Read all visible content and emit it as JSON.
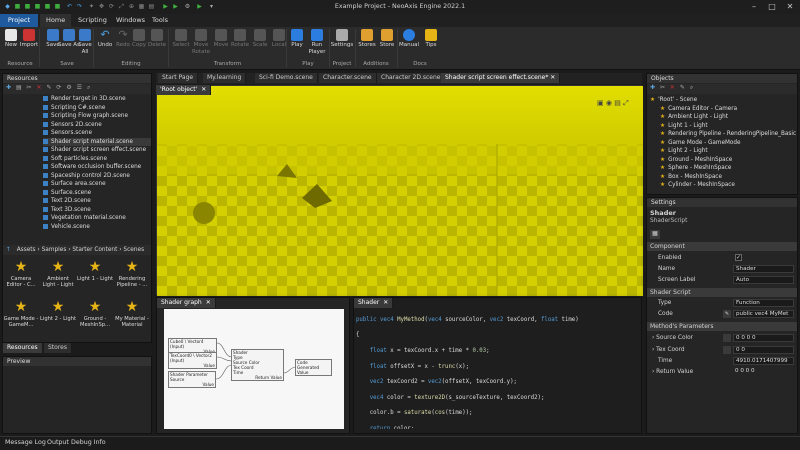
{
  "window": {
    "title": "Example Project - NeoAxis Engine 2022.1"
  },
  "menu": {
    "project": "Project",
    "home": "Home",
    "scripting": "Scripting",
    "windows": "Windows",
    "tools": "Tools"
  },
  "ribbon": {
    "new": "New",
    "import": "Import",
    "save": "Save",
    "save_as": "Save As",
    "save_all": "Save All",
    "undo": "Undo",
    "redo": "Redo",
    "copy": "Copy",
    "delete": "Delete",
    "select": "Select",
    "move_rotate": "Move Rotate",
    "move": "Move",
    "rotate": "Rotate",
    "scale": "Scale",
    "local": "Local",
    "play": "Play",
    "run_player": "Run Player",
    "settings": "Settings",
    "stores": "Stores",
    "store": "Store",
    "manual": "Manual",
    "tips": "Tips",
    "groups": {
      "resource": "Resource",
      "save": "Save",
      "editing": "Editing",
      "transform": "Transform",
      "play": "Play",
      "project": "Project",
      "additions": "Additions",
      "docs": "Docs"
    }
  },
  "resources": {
    "title": "Resources",
    "files": [
      "Render target in 3D.scene",
      "Scripting C#.scene",
      "Scripting Flow graph.scene",
      "Sensors 2D.scene",
      "Sensors.scene",
      "Shader script material.scene",
      "Shader script screen effect.scene",
      "Soft particles.scene",
      "Software occlusion buffer.scene",
      "Spaceship control 2D.scene",
      "Surface area.scene",
      "Surface.scene",
      "Text 2D.scene",
      "Text 3D.scene",
      "Vegetation material.scene",
      "Vehicle.scene"
    ],
    "breadcrumb": [
      "Assets",
      "Samples",
      "Starter Content",
      "Scenes"
    ],
    "thumbs": [
      "Camera Editor - C...",
      "Ambient Light - Light",
      "Light 1 - Light",
      "Rendering Pipeline - ...",
      "Game Mode - GameM...",
      "Light 2 - Light",
      "Ground - MeshInSp...",
      "My Material - Material"
    ],
    "tabs": [
      "Resources",
      "Stores"
    ]
  },
  "preview": {
    "title": "Preview"
  },
  "doc_tabs": [
    "Start Page",
    "My.learning",
    "Sci-fi Demo.scene",
    "Character.scene",
    "Character 2D.scene",
    "Shader script screen effect.scene*"
  ],
  "viewport": {
    "tab": "'Root object'"
  },
  "shader_graph": {
    "tab": "Shader graph",
    "nodes": {
      "n1": "Cube0 \\ Vector4 (Input)",
      "n1b": "Value",
      "n2": "TexCoord0 \\ Vector2 (Input)",
      "n2b": "Value",
      "n3": "Shader Parameter",
      "n3b": "Source",
      "n3c": "Value",
      "n4": "Shader",
      "n4a": "Type",
      "n4b": "Source Color",
      "n4c": "Tex Coord",
      "n4d": "Time",
      "n4e": "Return Value",
      "n5": "Code Generated",
      "n5b": "Value"
    }
  },
  "shader_code": {
    "tab": "Shader",
    "l1": "public vec4 MyMethod(vec4 sourceColor, vec2 texCoord, float time)",
    "l2": "{",
    "l3": "    float x = texCoord.x + time * 0.03;",
    "l4": "    float offsetX = x - trunc(x);",
    "l5": "    vec2 texCoord2 = vec2(offsetX, texCoord.y);",
    "l6": "    vec4 color = texture2D(s_sourceTexture, texCoord2);",
    "l7": "    color.b = saturate(cos(time));",
    "l8": "    return color;",
    "l9": "}"
  },
  "objects": {
    "title": "Objects",
    "items": [
      "'Root' - Scene",
      "Camera Editor - Camera",
      "Ambient Light - Light",
      "Light 1 - Light",
      "Rendering Pipeline - RenderingPipeline_Basic",
      "Game Mode - GameMode",
      "Light 2 - Light",
      "Ground - MeshInSpace",
      "Sphere - MeshInSpace",
      "Box - MeshInSpace",
      "Cylinder - MeshInSpace"
    ]
  },
  "settings": {
    "title": "Settings",
    "obj_name": "Shader",
    "obj_type": "ShaderScript",
    "sec_component": "Component",
    "enabled": "Enabled",
    "name_label": "Name",
    "name_value": "Shader",
    "screen_label": "Screen Label",
    "screen_value": "Auto",
    "sec_script": "Shader Script",
    "type_label": "Type",
    "type_value": "Function",
    "code_label": "Code",
    "code_value": "public vec4 MyMet",
    "sec_params": "Method's Parameters",
    "source_color": "Source Color",
    "source_color_v": "0 0 0 0",
    "tex_coord": "Tex Coord",
    "tex_coord_v": "0 0",
    "time": "Time",
    "time_v": "4910.0171407999",
    "return_value": "Return Value",
    "return_value_v": "0 0 0 0"
  },
  "statusbar": {
    "message_log": "Message Log",
    "output": "Output",
    "debug_info": "Debug Info"
  },
  "colors": {
    "accent": "#1f5a9e",
    "viewport": "#d8d400"
  }
}
